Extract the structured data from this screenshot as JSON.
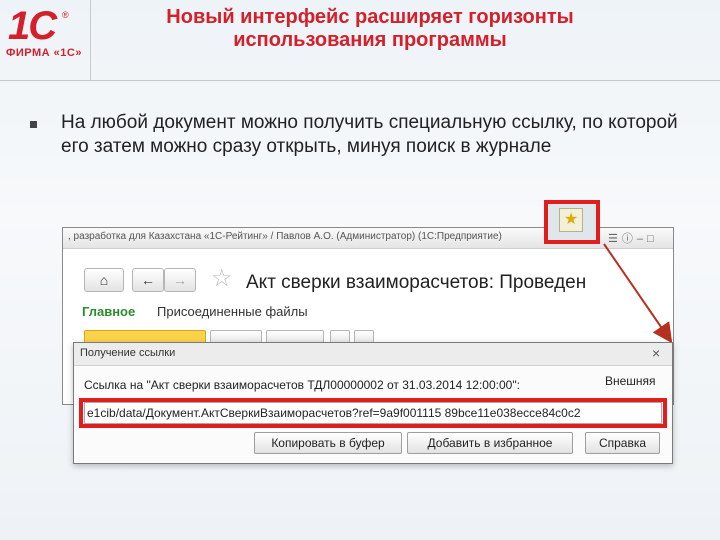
{
  "header": {
    "logo_text": "1С",
    "logo_firm": "ФИРМА «1С»",
    "title_line1": "Новый интерфейс расширяет горизонты",
    "title_line2": "использования программы"
  },
  "bullet": {
    "text": "На любой документ можно получить специальную ссылку, по которой его затем можно сразу открыть, минуя поиск в журнале"
  },
  "window": {
    "titlebar": ", разработка для Казахстана «1С-Рейтинг» / Павлов А.О. (Администратор) (1С:Предприятие)",
    "doc_title": "Акт сверки взаиморасчетов: Проведен",
    "tabs": [
      "Главное",
      "Присоединенные файлы"
    ]
  },
  "dialog": {
    "title": "Получение ссылки",
    "close": "×",
    "label": "Ссылка на \"Акт сверки взаиморасчетов ТДЛ00000002 от 31.03.2014 12:00:00\":",
    "external": "Внешняя",
    "url_value": "e1cib/data/Документ.АктСверкиВзаиморасчетов?ref=9a9f001115 89bce11e038ecce84c0c2",
    "buttons": {
      "copy": "Копировать в буфер",
      "favorites": "Добавить в избранное",
      "help": "Справка"
    }
  },
  "icons": {
    "home": "home-icon",
    "back": "arrow-left-icon",
    "forward": "arrow-right-icon",
    "favorite": "star-icon"
  },
  "colors": {
    "accent": "#d3202a",
    "highlight": "#e01e1e",
    "active_tab": "#2f8a2f"
  }
}
